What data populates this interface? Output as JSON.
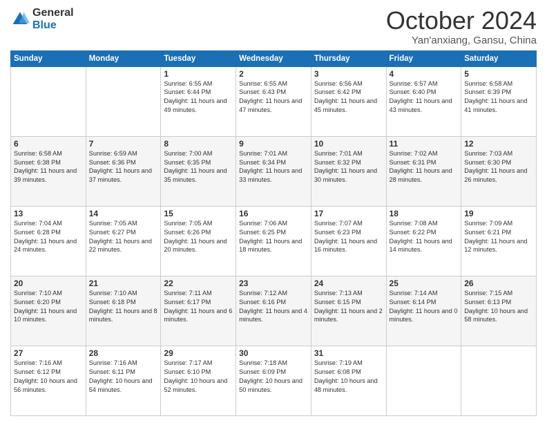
{
  "logo": {
    "general": "General",
    "blue": "Blue"
  },
  "title": {
    "month": "October 2024",
    "location": "Yan'anxiang, Gansu, China"
  },
  "weekdays": [
    "Sunday",
    "Monday",
    "Tuesday",
    "Wednesday",
    "Thursday",
    "Friday",
    "Saturday"
  ],
  "weeks": [
    [
      {
        "day": "",
        "sunrise": "",
        "sunset": "",
        "daylight": ""
      },
      {
        "day": "",
        "sunrise": "",
        "sunset": "",
        "daylight": ""
      },
      {
        "day": "1",
        "sunrise": "Sunrise: 6:55 AM",
        "sunset": "Sunset: 6:44 PM",
        "daylight": "Daylight: 11 hours and 49 minutes."
      },
      {
        "day": "2",
        "sunrise": "Sunrise: 6:55 AM",
        "sunset": "Sunset: 6:43 PM",
        "daylight": "Daylight: 11 hours and 47 minutes."
      },
      {
        "day": "3",
        "sunrise": "Sunrise: 6:56 AM",
        "sunset": "Sunset: 6:42 PM",
        "daylight": "Daylight: 11 hours and 45 minutes."
      },
      {
        "day": "4",
        "sunrise": "Sunrise: 6:57 AM",
        "sunset": "Sunset: 6:40 PM",
        "daylight": "Daylight: 11 hours and 43 minutes."
      },
      {
        "day": "5",
        "sunrise": "Sunrise: 6:58 AM",
        "sunset": "Sunset: 6:39 PM",
        "daylight": "Daylight: 11 hours and 41 minutes."
      }
    ],
    [
      {
        "day": "6",
        "sunrise": "Sunrise: 6:58 AM",
        "sunset": "Sunset: 6:38 PM",
        "daylight": "Daylight: 11 hours and 39 minutes."
      },
      {
        "day": "7",
        "sunrise": "Sunrise: 6:59 AM",
        "sunset": "Sunset: 6:36 PM",
        "daylight": "Daylight: 11 hours and 37 minutes."
      },
      {
        "day": "8",
        "sunrise": "Sunrise: 7:00 AM",
        "sunset": "Sunset: 6:35 PM",
        "daylight": "Daylight: 11 hours and 35 minutes."
      },
      {
        "day": "9",
        "sunrise": "Sunrise: 7:01 AM",
        "sunset": "Sunset: 6:34 PM",
        "daylight": "Daylight: 11 hours and 33 minutes."
      },
      {
        "day": "10",
        "sunrise": "Sunrise: 7:01 AM",
        "sunset": "Sunset: 6:32 PM",
        "daylight": "Daylight: 11 hours and 30 minutes."
      },
      {
        "day": "11",
        "sunrise": "Sunrise: 7:02 AM",
        "sunset": "Sunset: 6:31 PM",
        "daylight": "Daylight: 11 hours and 28 minutes."
      },
      {
        "day": "12",
        "sunrise": "Sunrise: 7:03 AM",
        "sunset": "Sunset: 6:30 PM",
        "daylight": "Daylight: 11 hours and 26 minutes."
      }
    ],
    [
      {
        "day": "13",
        "sunrise": "Sunrise: 7:04 AM",
        "sunset": "Sunset: 6:28 PM",
        "daylight": "Daylight: 11 hours and 24 minutes."
      },
      {
        "day": "14",
        "sunrise": "Sunrise: 7:05 AM",
        "sunset": "Sunset: 6:27 PM",
        "daylight": "Daylight: 11 hours and 22 minutes."
      },
      {
        "day": "15",
        "sunrise": "Sunrise: 7:05 AM",
        "sunset": "Sunset: 6:26 PM",
        "daylight": "Daylight: 11 hours and 20 minutes."
      },
      {
        "day": "16",
        "sunrise": "Sunrise: 7:06 AM",
        "sunset": "Sunset: 6:25 PM",
        "daylight": "Daylight: 11 hours and 18 minutes."
      },
      {
        "day": "17",
        "sunrise": "Sunrise: 7:07 AM",
        "sunset": "Sunset: 6:23 PM",
        "daylight": "Daylight: 11 hours and 16 minutes."
      },
      {
        "day": "18",
        "sunrise": "Sunrise: 7:08 AM",
        "sunset": "Sunset: 6:22 PM",
        "daylight": "Daylight: 11 hours and 14 minutes."
      },
      {
        "day": "19",
        "sunrise": "Sunrise: 7:09 AM",
        "sunset": "Sunset: 6:21 PM",
        "daylight": "Daylight: 11 hours and 12 minutes."
      }
    ],
    [
      {
        "day": "20",
        "sunrise": "Sunrise: 7:10 AM",
        "sunset": "Sunset: 6:20 PM",
        "daylight": "Daylight: 11 hours and 10 minutes."
      },
      {
        "day": "21",
        "sunrise": "Sunrise: 7:10 AM",
        "sunset": "Sunset: 6:18 PM",
        "daylight": "Daylight: 11 hours and 8 minutes."
      },
      {
        "day": "22",
        "sunrise": "Sunrise: 7:11 AM",
        "sunset": "Sunset: 6:17 PM",
        "daylight": "Daylight: 11 hours and 6 minutes."
      },
      {
        "day": "23",
        "sunrise": "Sunrise: 7:12 AM",
        "sunset": "Sunset: 6:16 PM",
        "daylight": "Daylight: 11 hours and 4 minutes."
      },
      {
        "day": "24",
        "sunrise": "Sunrise: 7:13 AM",
        "sunset": "Sunset: 6:15 PM",
        "daylight": "Daylight: 11 hours and 2 minutes."
      },
      {
        "day": "25",
        "sunrise": "Sunrise: 7:14 AM",
        "sunset": "Sunset: 6:14 PM",
        "daylight": "Daylight: 11 hours and 0 minutes."
      },
      {
        "day": "26",
        "sunrise": "Sunrise: 7:15 AM",
        "sunset": "Sunset: 6:13 PM",
        "daylight": "Daylight: 10 hours and 58 minutes."
      }
    ],
    [
      {
        "day": "27",
        "sunrise": "Sunrise: 7:16 AM",
        "sunset": "Sunset: 6:12 PM",
        "daylight": "Daylight: 10 hours and 56 minutes."
      },
      {
        "day": "28",
        "sunrise": "Sunrise: 7:16 AM",
        "sunset": "Sunset: 6:11 PM",
        "daylight": "Daylight: 10 hours and 54 minutes."
      },
      {
        "day": "29",
        "sunrise": "Sunrise: 7:17 AM",
        "sunset": "Sunset: 6:10 PM",
        "daylight": "Daylight: 10 hours and 52 minutes."
      },
      {
        "day": "30",
        "sunrise": "Sunrise: 7:18 AM",
        "sunset": "Sunset: 6:09 PM",
        "daylight": "Daylight: 10 hours and 50 minutes."
      },
      {
        "day": "31",
        "sunrise": "Sunrise: 7:19 AM",
        "sunset": "Sunset: 6:08 PM",
        "daylight": "Daylight: 10 hours and 48 minutes."
      },
      {
        "day": "",
        "sunrise": "",
        "sunset": "",
        "daylight": ""
      },
      {
        "day": "",
        "sunrise": "",
        "sunset": "",
        "daylight": ""
      }
    ]
  ]
}
